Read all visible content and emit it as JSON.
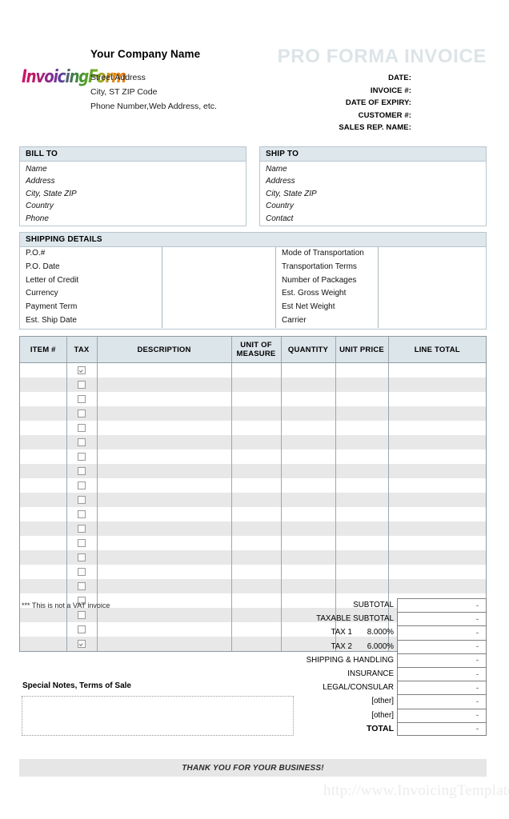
{
  "header": {
    "logo_text": "InvoicingForm",
    "company_name": "Your Company Name",
    "address_lines": [
      "Street Address",
      "City, ST  ZIP Code",
      "Phone Number,Web Address, etc."
    ],
    "doc_title": "PRO FORMA INVOICE",
    "meta_labels": [
      "DATE:",
      "INVOICE #:",
      "DATE OF EXPIRY:",
      "CUSTOMER #:",
      "SALES REP. NAME:"
    ]
  },
  "bill_to": {
    "title": "BILL TO",
    "lines": [
      "Name",
      "Address",
      "City, State ZIP",
      "Country",
      "Phone"
    ]
  },
  "ship_to": {
    "title": "SHIP TO",
    "lines": [
      "Name",
      "Address",
      "City, State ZIP",
      "Country",
      "Contact"
    ]
  },
  "shipping_details": {
    "title": "SHIPPING DETAILS",
    "left_labels": [
      "P.O.#",
      "P.O. Date",
      "Letter of Credit",
      "Currency",
      "Payment Term",
      "Est. Ship Date"
    ],
    "right_labels": [
      "Mode of Transportation",
      "Transportation Terms",
      "Number of Packages",
      "Est. Gross Weight",
      "Est Net Weight",
      "Carrier"
    ]
  },
  "items_table": {
    "columns": [
      "ITEM #",
      "TAX",
      "DESCRIPTION",
      "UNIT OF MEASURE",
      "QUANTITY",
      "UNIT PRICE",
      "LINE TOTAL"
    ],
    "row_count": 20,
    "checked_rows": [
      0,
      19
    ]
  },
  "vat_note": "*** This is not a VAT invoice",
  "totals": [
    {
      "label": "SUBTOTAL",
      "rate": "",
      "value": "-"
    },
    {
      "label": "TAXABLE SUBTOTAL",
      "rate": "",
      "value": "-"
    },
    {
      "label": "TAX 1",
      "rate": "8.000%",
      "value": "-"
    },
    {
      "label": "TAX 2",
      "rate": "6.000%",
      "value": "-"
    },
    {
      "label": "SHIPPING & HANDLING",
      "rate": "",
      "value": "-"
    },
    {
      "label": "INSURANCE",
      "rate": "",
      "value": "-"
    },
    {
      "label": "LEGAL/CONSULAR",
      "rate": "",
      "value": "-"
    },
    {
      "label": "[other]",
      "rate": "",
      "value": "-"
    },
    {
      "label": "[other]",
      "rate": "",
      "value": "-"
    },
    {
      "label": "TOTAL",
      "rate": "",
      "value": "-"
    }
  ],
  "notes": {
    "label": "Special Notes, Terms of Sale",
    "value": ""
  },
  "footer": {
    "thanks": "THANK YOU FOR YOUR BUSINESS!",
    "watermark": "http://www.InvoicingTemplate.com"
  },
  "colors": {
    "band": "#dde7ec",
    "title": "#dde4e8",
    "table_header": "#dce5ea",
    "row_alt": "#e8e8e8",
    "footer_band": "#e6e6e6"
  }
}
